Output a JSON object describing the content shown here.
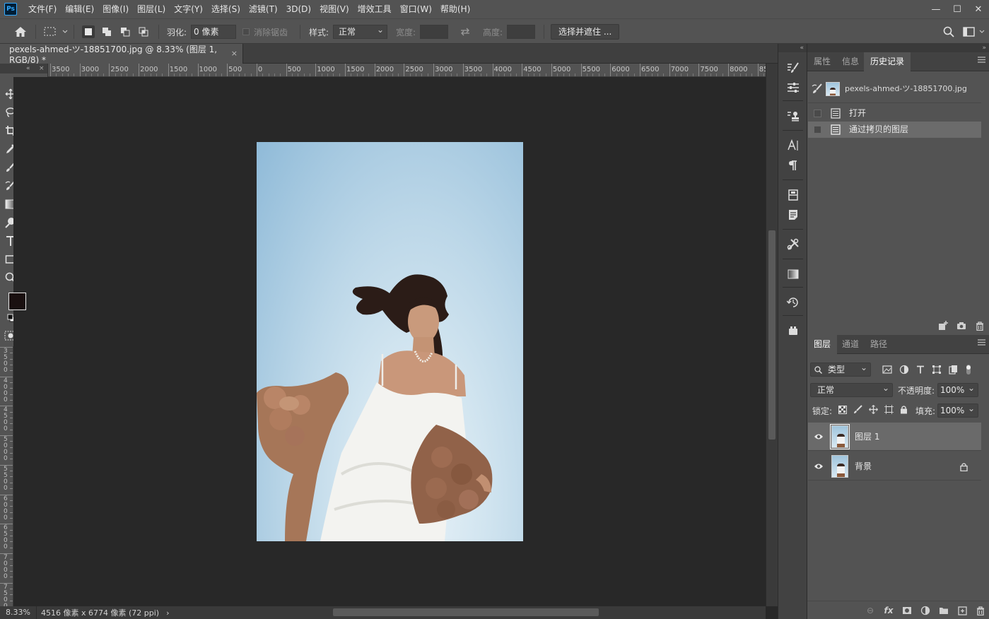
{
  "app": {
    "logo": "Ps"
  },
  "menu": [
    "文件(F)",
    "编辑(E)",
    "图像(I)",
    "图层(L)",
    "文字(Y)",
    "选择(S)",
    "滤镜(T)",
    "3D(D)",
    "视图(V)",
    "增效工具",
    "窗口(W)",
    "帮助(H)"
  ],
  "window_controls": {
    "minimize": "—",
    "restore": "☐",
    "close": "✕"
  },
  "options": {
    "feather_label": "羽化:",
    "feather_value": "0 像素",
    "antialias_label": "消除锯齿",
    "style_label": "样式:",
    "style_value": "正常",
    "width_label": "宽度:",
    "height_label": "高度:",
    "select_mask_label": "选择并遮住 ..."
  },
  "document": {
    "tab_title": "pexels-ahmed-ツ-18851700.jpg @ 8.33% (图层 1, RGB/8) *",
    "close": "×"
  },
  "ruler": {
    "h_labels": [
      "3500",
      "3000",
      "2500",
      "2000",
      "1500",
      "1000",
      "500",
      "0",
      "500",
      "1000",
      "1500",
      "2000",
      "2500",
      "3000",
      "3500",
      "4000",
      "4500",
      "5000",
      "5500",
      "6000",
      "6500",
      "7000",
      "7500",
      "8000",
      "85"
    ],
    "v_labels": [
      "3\n5\n0\n0",
      "4\n0\n0\n0",
      "4\n5\n0\n0",
      "5\n0\n0\n0",
      "5\n5\n0\n0",
      "6\n0\n0\n0",
      "6\n5\n0\n0",
      "7\n0\n0\n0",
      "7\n5\n0\n0"
    ]
  },
  "toolbox": {
    "collapse": "«",
    "close": "×"
  },
  "status": {
    "zoom": "8.33%",
    "info": "4516 像素 x 6774 像素 (72 ppi)",
    "arrow": "›"
  },
  "panels": {
    "collapse_left": "«",
    "collapse_right": "»",
    "top_tabs": [
      "属性",
      "信息",
      "历史记录"
    ],
    "history": {
      "snapshot_name": "pexels-ahmed-ツ-18851700.jpg",
      "items": [
        "打开",
        "通过拷贝的图层"
      ]
    },
    "layer_tabs": [
      "图层",
      "通道",
      "路径"
    ],
    "layers": {
      "filter_kind": "类型",
      "blend_mode": "正常",
      "opacity_label": "不透明度:",
      "opacity_value": "100%",
      "lock_label": "锁定:",
      "fill_label": "填充:",
      "fill_value": "100%",
      "items": [
        {
          "name": "图层 1"
        },
        {
          "name": "背景"
        }
      ],
      "footer": {
        "link": "⊖",
        "fx": "fx"
      }
    }
  },
  "colors": {
    "ui_bg": "#535353",
    "canvas_bg": "#282828",
    "foreground": "#1a1010",
    "background": "#ffffff",
    "selection": "#6a6a6a"
  }
}
